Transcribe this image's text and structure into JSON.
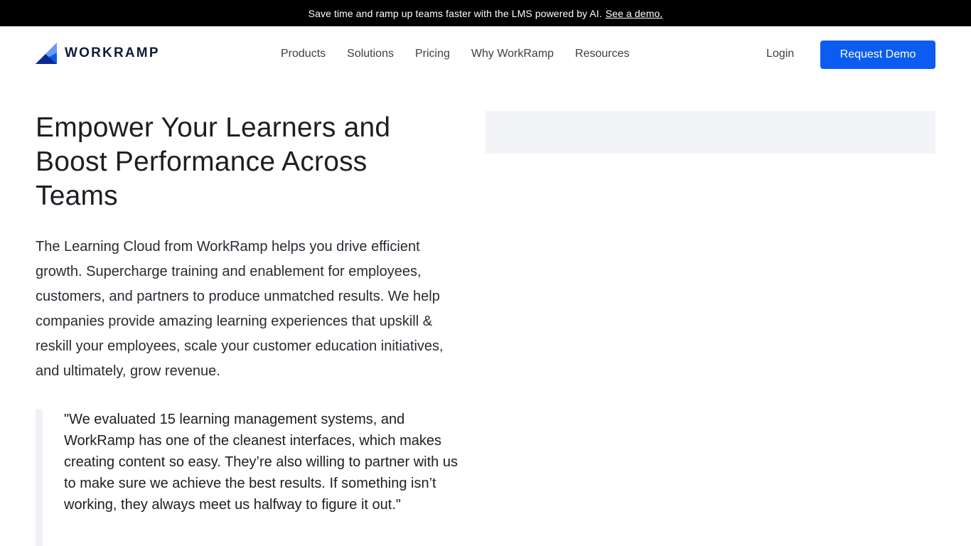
{
  "banner": {
    "text": "Save time and ramp up teams faster with the LMS powered by AI.",
    "link_label": "See a demo."
  },
  "header": {
    "logo_text": "WORKRAMP",
    "nav": [
      "Products",
      "Solutions",
      "Pricing",
      "Why WorkRamp",
      "Resources"
    ],
    "login_label": "Login",
    "cta_label": "Request Demo"
  },
  "hero": {
    "title": "Empower Your Learners and Boost Performance Across Teams",
    "description": "The Learning Cloud from WorkRamp helps you drive efficient growth. Supercharge training and enablement for employees, customers, and partners to produce unmatched results. We help companies provide amazing learning experiences that upskill & reskill your employees, scale your customer education initiatives, and ultimately, grow revenue."
  },
  "testimonial": {
    "quote": "\"We evaluated 15 learning management systems, and WorkRamp has one of the cleanest interfaces, which makes creating content so easy. They’re also willing to partner with us to make sure we achieve the best results. If something isn’t working, they always meet us halfway to figure it out.\""
  },
  "colors": {
    "brand_blue": "#0b5cf0",
    "banner_bg": "#000000",
    "logo_dark": "#0e1b3d",
    "placeholder_bg": "#f3f4f7"
  },
  "icons": {
    "logo": "workramp-logo-icon"
  }
}
